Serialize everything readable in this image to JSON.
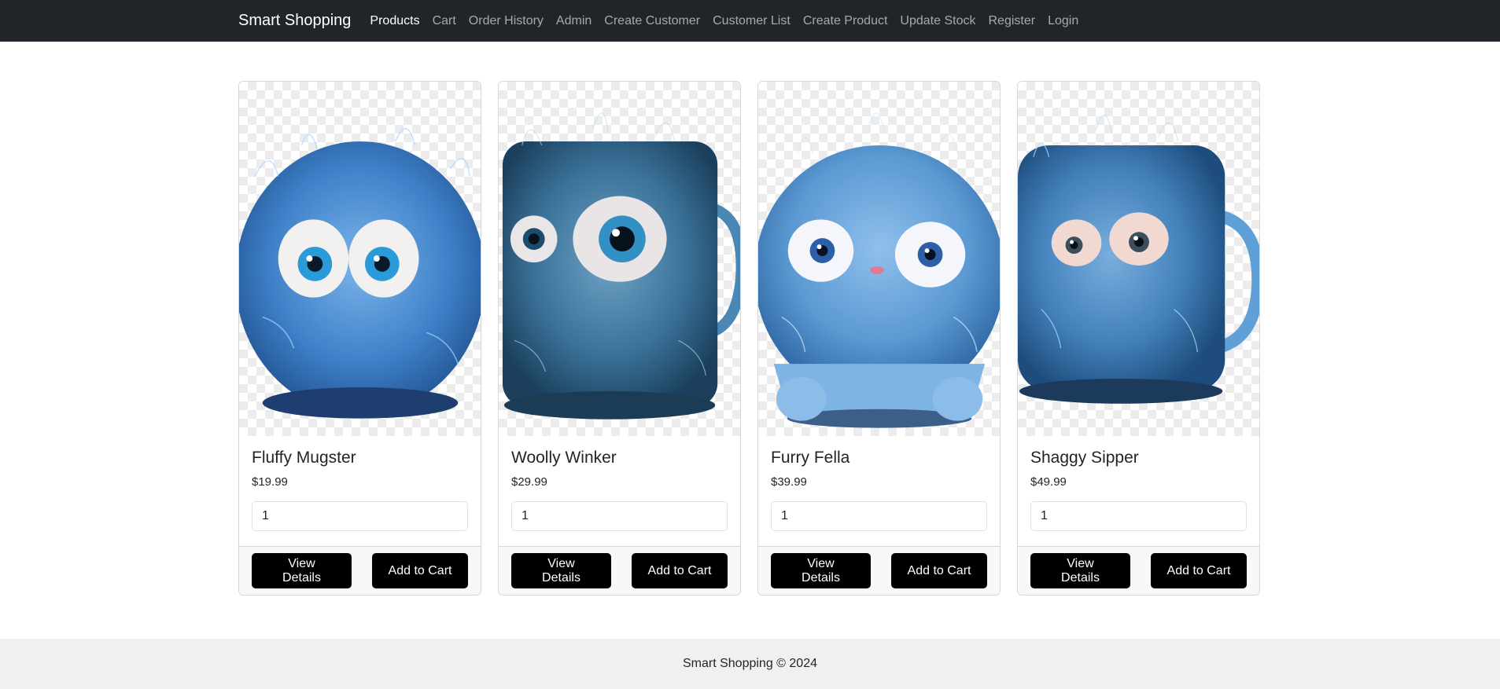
{
  "nav": {
    "brand": "Smart Shopping",
    "items": [
      {
        "label": "Products",
        "active": true
      },
      {
        "label": "Cart"
      },
      {
        "label": "Order History"
      },
      {
        "label": "Admin"
      },
      {
        "label": "Create Customer"
      },
      {
        "label": "Customer List"
      },
      {
        "label": "Create Product"
      },
      {
        "label": "Update Stock"
      },
      {
        "label": "Register"
      },
      {
        "label": "Login"
      }
    ]
  },
  "products": [
    {
      "name": "Fluffy Mugster",
      "price": "$19.99",
      "quantity": "1",
      "details_label": "View Details",
      "cart_label": "Add to Cart",
      "fur_color": "#4a8fd0"
    },
    {
      "name": "Woolly Winker",
      "price": "$29.99",
      "quantity": "1",
      "details_label": "View Details",
      "cart_label": "Add to Cart",
      "fur_color": "#3f7fa8"
    },
    {
      "name": "Furry Fella",
      "price": "$39.99",
      "quantity": "1",
      "details_label": "View Details",
      "cart_label": "Add to Cart",
      "fur_color": "#5a9ad6"
    },
    {
      "name": "Shaggy Sipper",
      "price": "$49.99",
      "quantity": "1",
      "details_label": "View Details",
      "cart_label": "Add to Cart",
      "fur_color": "#4b8cc4"
    }
  ],
  "footer": {
    "text": "Smart Shopping © 2024"
  }
}
